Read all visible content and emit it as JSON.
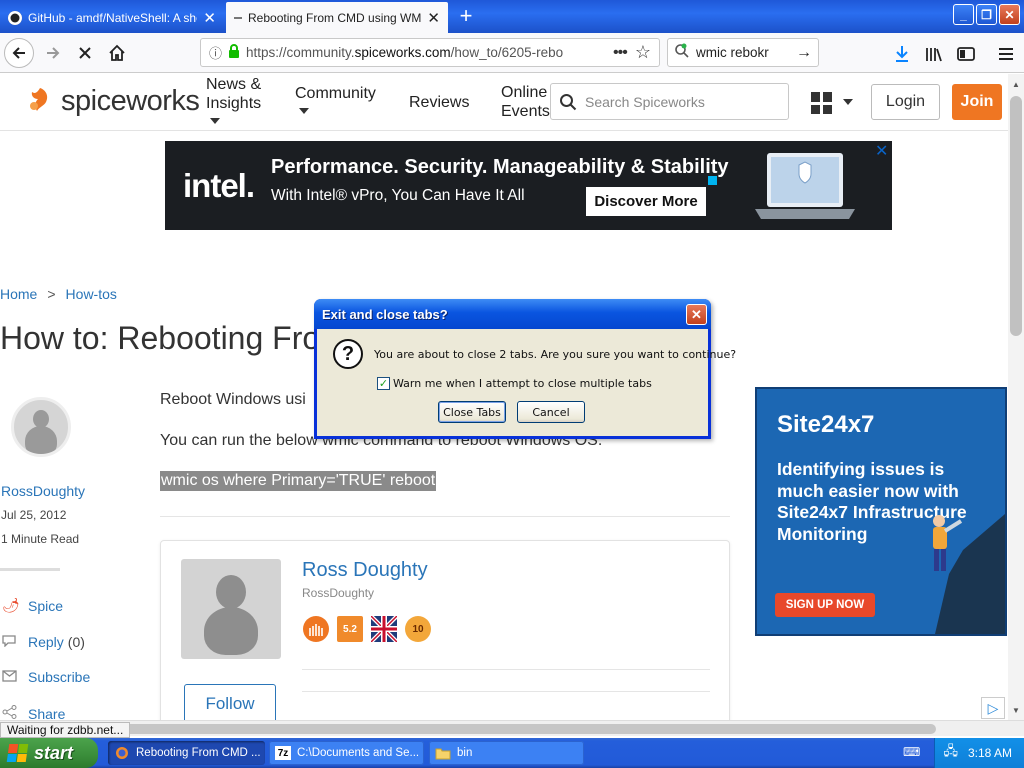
{
  "browser": {
    "tabs": [
      {
        "title": "GitHub - amdf/NativeShell: A shel",
        "active": false
      },
      {
        "title": "Rebooting From CMD using WMIC",
        "active": true
      }
    ],
    "new_tab_label": "+",
    "url_prefix": "https://community.",
    "url_domain": "spiceworks.com",
    "url_path": "/how_to/6205-rebo",
    "search_query": "wmic rebokr",
    "window_controls": [
      "_",
      "❐",
      "✕"
    ]
  },
  "site": {
    "logo_text": "spiceworks",
    "nav": [
      {
        "label": "News &\nInsights",
        "has_menu": true
      },
      {
        "label": "Community",
        "has_menu": true
      },
      {
        "label": "Reviews",
        "has_menu": false
      },
      {
        "label": "Online\nEvents",
        "has_menu": false
      }
    ],
    "search_placeholder": "Search Spiceworks",
    "login_label": "Login",
    "join_label": "Join"
  },
  "intel_ad": {
    "logo": "intel.",
    "headline": "Performance. Security. Manageability & Stability",
    "subline": "With Intel® vPro, You Can Have It All",
    "cta": "Discover More",
    "close": "✕"
  },
  "site24x7_ad": {
    "brand": "Site24x7",
    "copy": "Identifying issues is much easier now with Site24x7 Infrastructure Monitoring",
    "cta": "SIGN UP NOW"
  },
  "article": {
    "breadcrumb": [
      "Home",
      ">",
      "How-tos"
    ],
    "title": "How to: Rebooting From CMD using WMIC",
    "author": "RossDoughty",
    "date": "Jul 25, 2012",
    "read_time": "1 Minute Read",
    "actions": [
      {
        "label": "Spice",
        "count": ""
      },
      {
        "label": "Reply",
        "count": "(0)"
      },
      {
        "label": "Subscribe",
        "count": ""
      },
      {
        "label": "Share",
        "count": ""
      }
    ],
    "para1": "Reboot Windows usi",
    "para2": "You can run the below wmic command to reboot Windows OS.",
    "code": "wmic os where Primary='TRUE' reboot",
    "profile": {
      "name": "Ross Doughty",
      "handle": "RossDoughty",
      "badges": [
        "",
        "5.2",
        "",
        "10"
      ],
      "follow_label": "Follow"
    }
  },
  "status_text": "Waiting for zdbb.net...",
  "dialog": {
    "title": "Exit and close tabs?",
    "message": "You are about to close 2 tabs. Are you sure you want to continue?",
    "checkbox_label": "Warn me when I attempt to close multiple tabs",
    "checkbox_checked": true,
    "close_tabs_label": "Close Tabs",
    "cancel_label": "Cancel"
  },
  "taskbar": {
    "start_label": "start",
    "tasks": [
      {
        "label": "Rebooting From CMD ...",
        "active": true
      },
      {
        "label": "C:\\Documents and Se...",
        "active": false
      },
      {
        "label": "bin",
        "active": false
      }
    ],
    "clock": "3:18 AM"
  },
  "colors": {
    "spiceworks_orange": "#ef7622",
    "link_blue": "#2a75b8",
    "xp_blue": "#245edb",
    "xp_start_green": "#3a8d3a"
  }
}
